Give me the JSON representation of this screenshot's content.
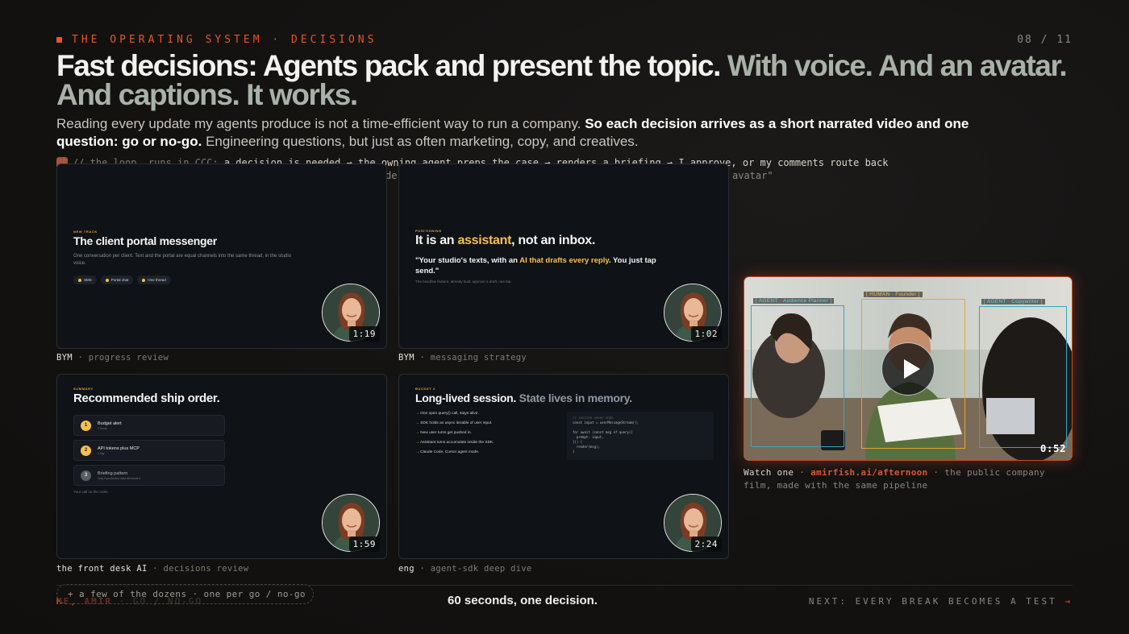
{
  "header": {
    "kicker": "THE OPERATING SYSTEM · DECISIONS",
    "page": "08 / 11"
  },
  "headline": {
    "main": "Fast decisions: Agents pack and present the topic.",
    "muted": "With voice. And an avatar. And captions. It works."
  },
  "subtitle": {
    "part1": "Reading every update my agents produce is not a time-efficient way to run a company.",
    "bold": "So each decision arrives as a short narrated video and one question: go or no-go.",
    "part2": "Engineering questions, but just as often marketing, copy, and creatives."
  },
  "loop": {
    "comment": "// the loop, runs in CCC:",
    "text": "a decision is needed → the owning agent preps the case → renders a briefing → I approve, or my comments route back",
    "line2_fragment_a": "de",
    "line2_fragment_b": "avatar\""
  },
  "cards": [
    {
      "eyebrow": "NEW TRACK",
      "title": "The client portal messenger",
      "body": "One conversation per client. Text and the portal are equal channels into the same thread, in the studio voice.",
      "pills": [
        "SMS",
        "Portal chat",
        "One thread"
      ],
      "duration": "1:19",
      "caption_owner": "BYM",
      "caption_topic": "progress review"
    },
    {
      "eyebrow": "POSITIONING",
      "title_a": "It is an ",
      "title_hl": "assistant",
      "title_b": ", not an inbox.",
      "quote_a": "\"Your studio's texts, with an ",
      "quote_hl": "AI that drafts every reply",
      "quote_b": ". You just tap send.\"",
      "note": "The headline feature, already built: approve a draft, one tap.",
      "duration": "1:02",
      "caption_owner": "BYM",
      "caption_topic": "messaging strategy"
    },
    {
      "eyebrow": "SUMMARY",
      "title": "Recommended ship order.",
      "items": [
        {
          "n": "1",
          "title": "Budget alert",
          "sub": "2 hours"
        },
        {
          "n": "2",
          "title": "API tokens plus MCP",
          "sub": "1 day"
        },
        {
          "n": "3",
          "title": "Briefing pattern",
          "sub": "Only if production data demands it"
        }
      ],
      "footer": "Your call on the order.",
      "duration": "1:59",
      "caption_owner": "the front desk AI",
      "caption_topic": "decisions review"
    },
    {
      "eyebrow": "BUCKET 2",
      "title_a": "Long-lived session. ",
      "title_b": "State lives in memory.",
      "bullets": [
        "One open query() call, stays alive.",
        "SDK holds an async iterable of user input.",
        "New user turns get pushed in.",
        "Assistant turns accumulate inside the SDK.",
        "Claude Code, Cursor agent mode."
      ],
      "code_comment": "// session never ends",
      "code": "const input = userMessageStream();\n\nfor await (const msg of query({\n  prompt: input,\n})) {\n  render(msg);\n}",
      "duration": "2:24",
      "caption_owner": "eng",
      "caption_topic": "agent-sdk deep dive"
    }
  ],
  "film": {
    "labels": [
      "[ AGENT · Audience Planner ]",
      "[ HUMAN · Founder ]",
      "[ AGENT · Copywriter ]"
    ],
    "duration": "0:52",
    "watch_a": "Watch one",
    "link": "amirfish.ai/afternoon",
    "watch_b": "the public company film, made with the same pipeline"
  },
  "footer": {
    "dozens": "+ a few of the dozens · one per go / no-go",
    "sig_name": "ME, AMIR",
    "sig_rest": "GO / NO-GO",
    "center": "60 seconds, one decision.",
    "next": "NEXT: EVERY BREAK BECOMES A TEST",
    "next_arrow": "→"
  },
  "colors": {
    "accent": "#e0562b",
    "highlight": "#f5c04e",
    "muted_headline": "#a8b2a8"
  },
  "icons": {
    "play": "play-icon",
    "kicker": "square-bullet-icon"
  }
}
